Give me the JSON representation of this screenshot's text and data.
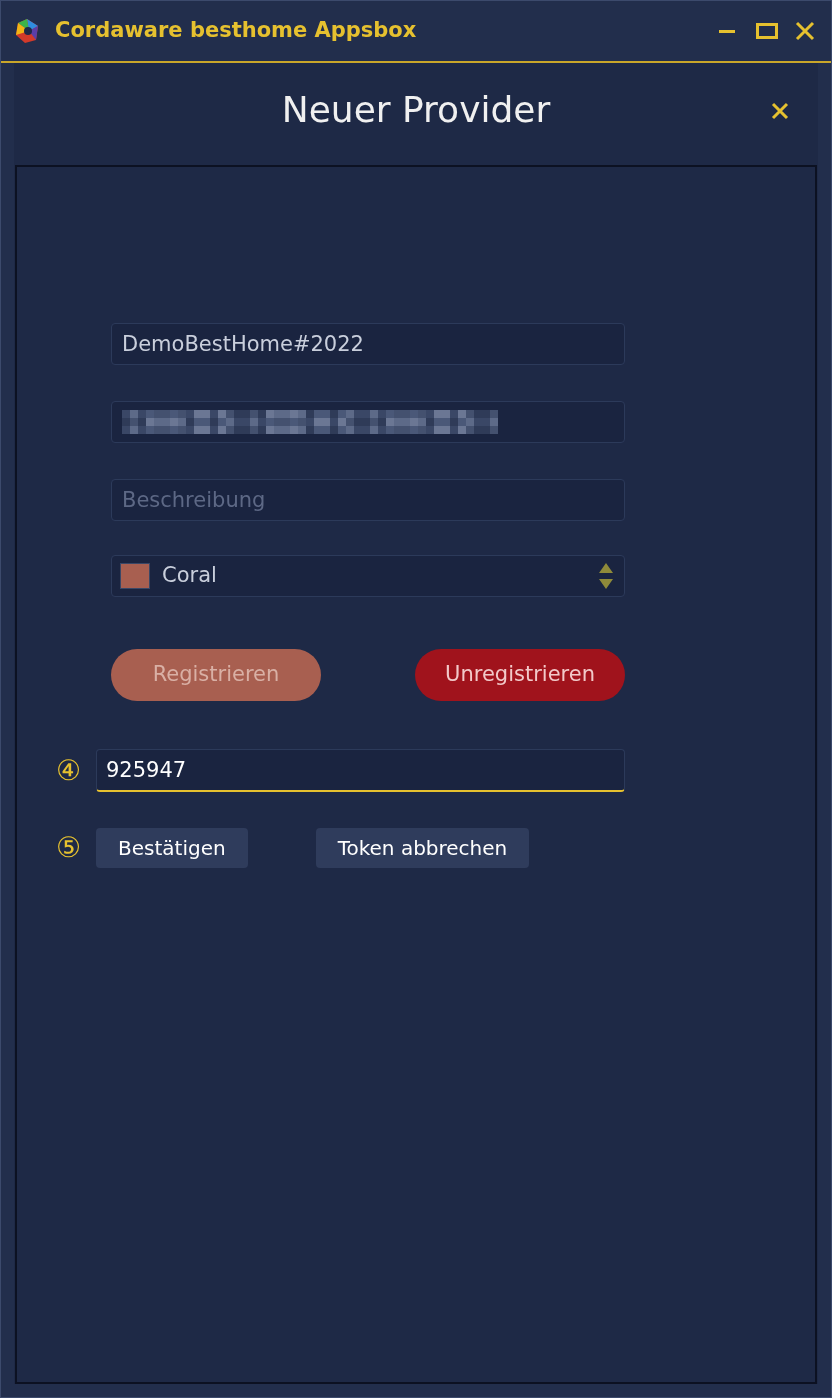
{
  "window": {
    "title": "Cordaware besthome Appsbox"
  },
  "dialog": {
    "title": "Neuer Provider"
  },
  "fields": [
    {
      "kind": "text",
      "value": "DemoBestHome#2022"
    },
    {
      "kind": "redacted"
    },
    {
      "kind": "text",
      "placeholder": "Beschreibung"
    },
    {
      "kind": "color",
      "value": "Coral",
      "color": "#a85f50"
    }
  ],
  "buttons": [
    {
      "label": "Registrieren",
      "color": "#a85f50",
      "disabled": true
    },
    {
      "label": "Unregistrieren",
      "color": "#a0131c",
      "disabled": false
    }
  ],
  "token": {
    "marker": "④",
    "value": "925947",
    "focused": true
  },
  "actions": {
    "marker": "⑤",
    "buttons": [
      "Bestätigen",
      "Token abbrechen"
    ]
  }
}
